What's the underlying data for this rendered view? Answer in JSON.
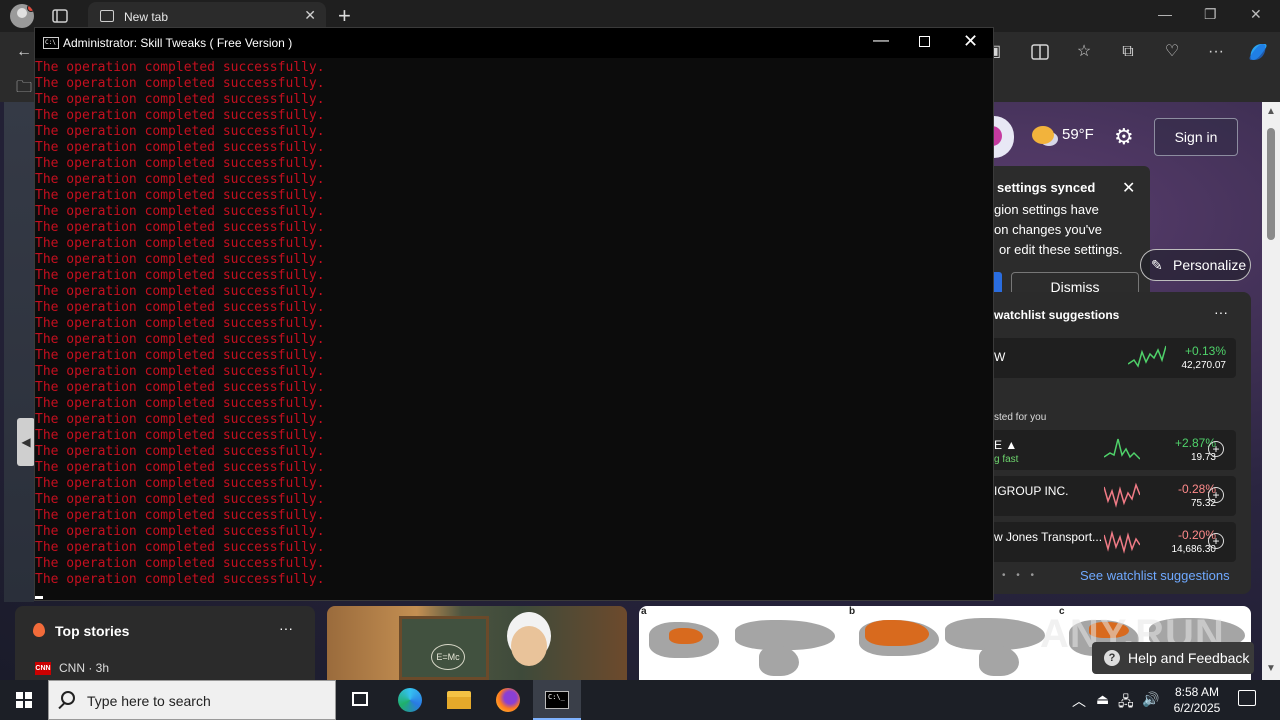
{
  "browser": {
    "tab_title": "New tab",
    "tab_close": "✕",
    "new_tab": "+",
    "window_controls": {
      "minimize": "—",
      "restore": "❐",
      "close": "✕"
    },
    "toolbar_icons": [
      "back-icon",
      "split-screen-icon",
      "favorites-icon",
      "collections-icon",
      "browser-essentials-icon",
      "more-icon",
      "copilot-icon"
    ]
  },
  "ntp": {
    "weather": {
      "temp": "59°F"
    },
    "sign_in": "Sign in",
    "sync_popup": {
      "title": "settings synced",
      "line1": "gion settings have",
      "line2": "on changes you've",
      "line3": "or edit these settings.",
      "dismiss": "Dismiss"
    },
    "personalize": "Personalize",
    "watchlist": {
      "title": "watchlist suggestions",
      "more": "···",
      "top_row": {
        "name": "W",
        "change": "+0.13%",
        "price": "42,270.07"
      },
      "suggested_label": "sted for you",
      "rows": [
        {
          "name": "E ▲",
          "sub": "g fast",
          "change": "+2.87%",
          "price": "19.73"
        },
        {
          "name": "IGROUP INC.",
          "sub": "",
          "change": "-0.28%",
          "price": "75.32"
        },
        {
          "name": "w Jones Transport...",
          "sub": "",
          "change": "-0.20%",
          "price": "14,686.30"
        }
      ],
      "see_link": "See watchlist suggestions"
    },
    "top_stories": {
      "title": "Top stories",
      "more": "···",
      "source_logo": "CNN",
      "source": "CNN · 3h"
    },
    "image_card": {
      "board_text": "E=Mc"
    },
    "map_labels": [
      "a",
      "b",
      "c"
    ],
    "watermark": "ANY.RUN",
    "help": "Help and Feedback"
  },
  "console": {
    "title": "Administrator:  Skill Tweaks ( Free Version )",
    "icon_text": "C:\\",
    "line_text": "The operation completed successfully.",
    "line_count": 33,
    "line_color": "#c50f1f"
  },
  "taskbar": {
    "search_placeholder": "Type here to search",
    "time": "8:58 AM",
    "date": "6/2/2025"
  }
}
